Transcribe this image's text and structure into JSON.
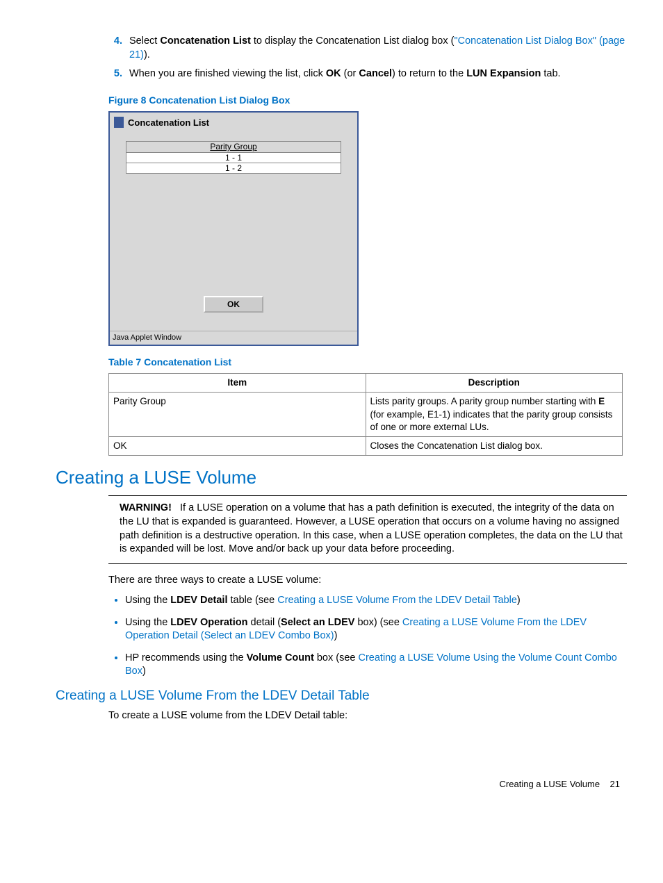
{
  "steps": [
    {
      "n": "4.",
      "pre": "Select ",
      "b1": "Concatenation List",
      "mid": " to display the Concatenation List dialog box (",
      "link": "\"Concatenation List Dialog Box\" (page 21)",
      "post": ")."
    },
    {
      "n": "5.",
      "pre": "When you are finished viewing the list, click ",
      "b1": "OK",
      "mid": " (or ",
      "b2": "Cancel",
      "mid2": ") to return to the ",
      "b3": "LUN Expansion",
      "post": " tab."
    }
  ],
  "figure_caption": "Figure 8 Concatenation List Dialog Box",
  "dialog": {
    "title": "Concatenation List",
    "col": "Parity Group",
    "rows": [
      "1 - 1",
      "1 - 2"
    ],
    "ok": "OK",
    "java": "Java Applet Window"
  },
  "table_caption": "Table 7 Concatenation List",
  "table": {
    "h1": "Item",
    "h2": "Description",
    "rows": [
      {
        "item": "Parity Group",
        "desc_pre": "Lists parity groups. A parity group number starting with ",
        "desc_b": "E",
        "desc_post": " (for example, E1-1) indicates that the parity group consists of one or more external LUs."
      },
      {
        "item": "OK",
        "desc_pre": "Closes the Concatenation List dialog box.",
        "desc_b": "",
        "desc_post": ""
      }
    ]
  },
  "h1": "Creating a LUSE Volume",
  "warning": {
    "label": "WARNING!",
    "text": "If a LUSE operation on a volume that has a path definition is executed, the integrity of the data on the LU that is expanded is guaranteed. However, a LUSE operation that occurs on a volume having no assigned path definition is a destructive operation. In this case, when a LUSE operation completes, the data on the LU that is expanded will be lost. Move and/or back up your data before proceeding."
  },
  "intro": "There are three ways to create a LUSE volume:",
  "bullets": [
    {
      "pre": "Using the ",
      "b": "LDEV Detail",
      "mid": " table (see ",
      "link": "Creating a LUSE Volume From the LDEV Detail Table",
      "post": ")"
    },
    {
      "pre": "Using the ",
      "b": "LDEV Operation",
      "mid": " detail (",
      "b2": "Select an LDEV",
      "mid2": " box) (see ",
      "link": "Creating a LUSE Volume From the LDEV Operation Detail (Select an LDEV Combo Box)",
      "post": ")"
    },
    {
      "pre": "HP recommends using the ",
      "b": "Volume Count",
      "mid": " box (see ",
      "link": "Creating a LUSE Volume Using the Volume Count Combo Box",
      "post": ")"
    }
  ],
  "h2": "Creating a LUSE Volume From the LDEV Detail Table",
  "h2_body": "To create a LUSE volume from the LDEV Detail table:",
  "footer": {
    "text": "Creating a LUSE Volume",
    "page": "21"
  }
}
